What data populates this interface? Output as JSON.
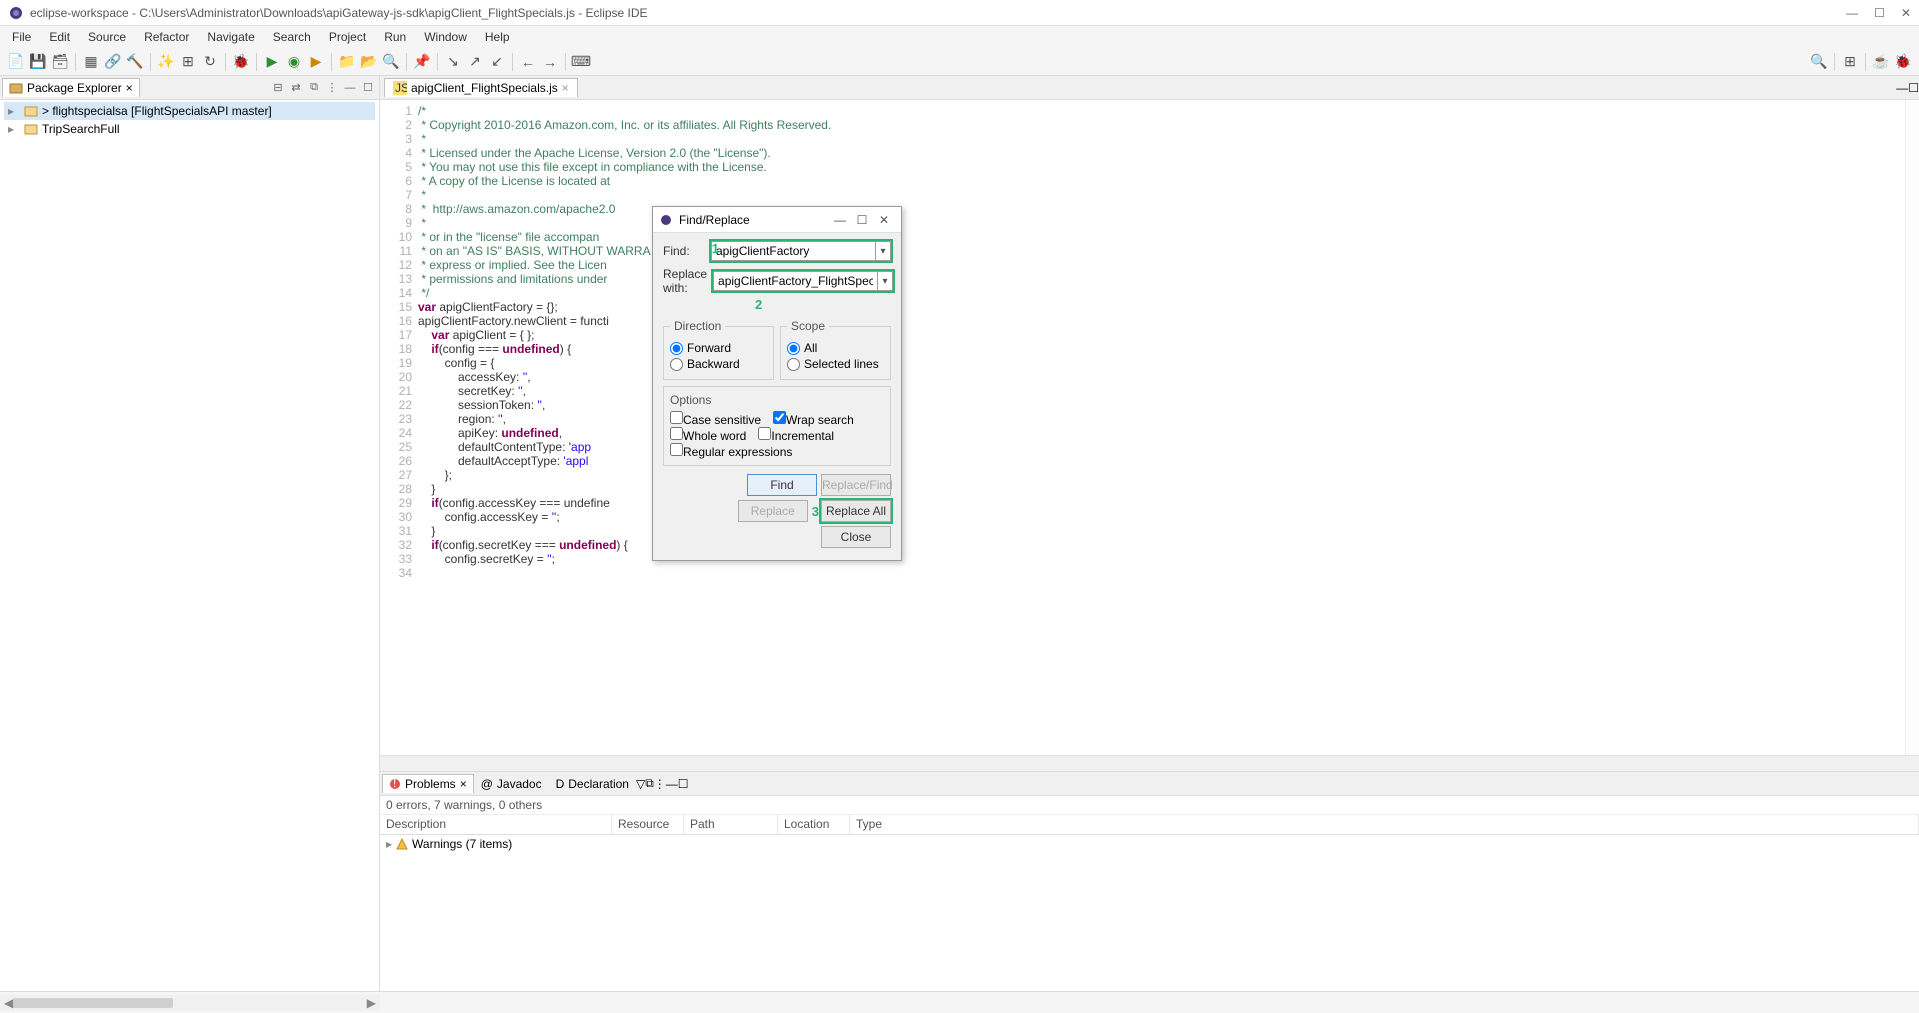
{
  "window": {
    "title": "eclipse-workspace - C:\\Users\\Administrator\\Downloads\\apiGateway-js-sdk\\apigClient_FlightSpecials.js - Eclipse IDE",
    "buttons": {
      "min": "—",
      "max": "☐",
      "close": "✕"
    }
  },
  "menu": [
    "File",
    "Edit",
    "Source",
    "Refactor",
    "Navigate",
    "Search",
    "Project",
    "Run",
    "Window",
    "Help"
  ],
  "package_explorer": {
    "title": "Package Explorer",
    "items": [
      {
        "label": "> flightspecialsa [FlightSpecialsAPI master]",
        "selected": true
      },
      {
        "label": "TripSearchFull",
        "selected": false
      }
    ]
  },
  "editor": {
    "tab": "apigClient_FlightSpecials.js",
    "lines": [
      "/*",
      " * Copyright 2010-2016 Amazon.com, Inc. or its affiliates. All Rights Reserved.",
      " *",
      " * Licensed under the Apache License, Version 2.0 (the \"License\").",
      " * You may not use this file except in compliance with the License.",
      " * A copy of the License is located at",
      " *",
      " *  http://aws.amazon.com/apache2.0",
      " *",
      " * or in the \"license\" file accompan",
      " * on an \"AS IS\" BASIS, WITHOUT WARRA",
      " * express or implied. See the Licen",
      " * permissions and limitations under",
      " */",
      "",
      "var apigClientFactory = {};",
      "apigClientFactory.newClient = functi",
      "    var apigClient = { };",
      "    if(config === undefined) {",
      "        config = {",
      "            accessKey: '',",
      "            secretKey: '',",
      "            sessionToken: '',",
      "            region: '',",
      "            apiKey: undefined,",
      "            defaultContentType: 'app",
      "            defaultAcceptType: 'appl",
      "        };",
      "    }",
      "    if(config.accessKey === undefine",
      "        config.accessKey = '';",
      "    }",
      "    if(config.secretKey === undefined) {",
      "        config.secretKey = '';"
    ]
  },
  "find_replace": {
    "title": "Find/Replace",
    "find_label": "Find:",
    "find_value": "apigClientFactory",
    "replace_label": "Replace with:",
    "replace_value": "apigClientFactory_FlightSpecials",
    "direction_title": "Direction",
    "forward": "Forward",
    "backward": "Backward",
    "scope_title": "Scope",
    "all": "All",
    "selected": "Selected lines",
    "options_title": "Options",
    "case_sensitive": "Case sensitive",
    "wrap_search": "Wrap search",
    "whole_word": "Whole word",
    "incremental": "Incremental",
    "regex": "Regular expressions",
    "btn_find": "Find",
    "btn_replace_find": "Replace/Find",
    "btn_replace": "Replace",
    "btn_replace_all": "Replace All",
    "btn_close": "Close",
    "marks": {
      "m1": "1",
      "m2": "2",
      "m3": "3"
    }
  },
  "problems": {
    "tabs": {
      "problems": "Problems",
      "javadoc": "Javadoc",
      "declaration": "Declaration"
    },
    "summary": "0 errors, 7 warnings, 0 others",
    "columns": {
      "description": "Description",
      "resource": "Resource",
      "path": "Path",
      "location": "Location",
      "type": "Type"
    },
    "row": "Warnings (7 items)"
  }
}
